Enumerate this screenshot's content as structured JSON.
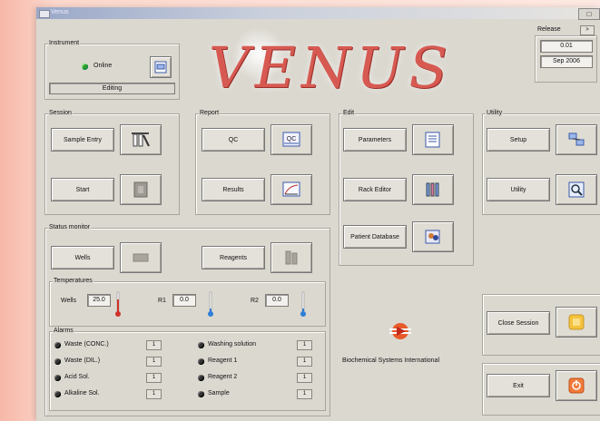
{
  "window": {
    "title": "Venus"
  },
  "app_logo": "VENUS",
  "instrument": {
    "label": "Instrument",
    "status": "Online",
    "mode": "Editing"
  },
  "release": {
    "label": "Release",
    "version": "0.01",
    "date": "Sep 2006",
    "button": ">"
  },
  "session": {
    "label": "Session",
    "sample_entry": "Sample Entry",
    "start": "Start"
  },
  "report": {
    "label": "Report",
    "qc": "QC",
    "results": "Results",
    "qc_icon_text": "QC"
  },
  "edit": {
    "label": "Edit",
    "parameters": "Parameters",
    "rack_editor": "Rack Editor",
    "patient_database": "Patient Database"
  },
  "utility": {
    "label": "Utility",
    "setup": "Setup",
    "utility": "Utility"
  },
  "status_monitor": {
    "label": "Status monitor",
    "wells": "Wells",
    "reagents": "Reagents"
  },
  "temperatures": {
    "label": "Temperatures",
    "wells_label": "Wells",
    "wells_value": "25.0",
    "r1_label": "R1",
    "r1_value": "0.0",
    "r2_label": "R2",
    "r2_value": "0.0"
  },
  "alarms": {
    "label": "Alarms",
    "items": [
      "Waste (CONC.)",
      "Waste (DIL.)",
      "Acid Sol.",
      "Alkaline Sol.",
      "Washing solution",
      "Reagent 1",
      "Reagent 2",
      "Sample"
    ],
    "button": "1"
  },
  "company": "Biochemical Systems International",
  "close_session": "Close Session",
  "exit": "Exit",
  "colors": {
    "alarm_red": "#d0302a",
    "thermo_blue": "#2f7ed8",
    "exit_orange": "#f07a3a",
    "close_yellow": "#f4c23c"
  }
}
